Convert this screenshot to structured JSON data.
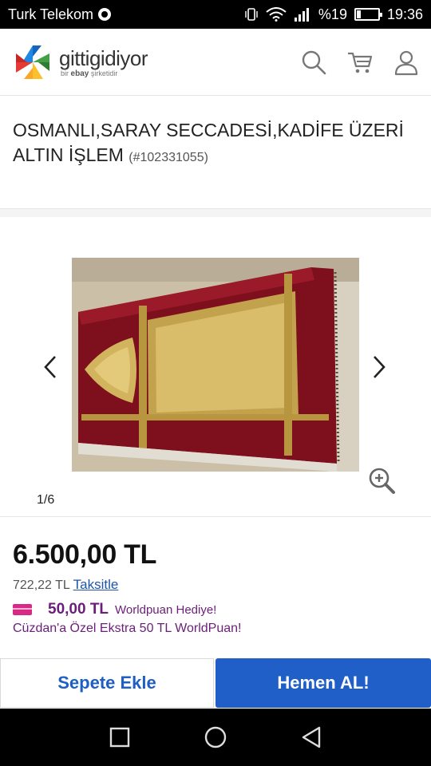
{
  "status_bar": {
    "carrier": "Turk Telekom",
    "battery": "%19",
    "battery_level": 0.19,
    "time": "19:36",
    "icons": [
      "whatsapp-icon",
      "vibrate-icon",
      "wifi-icon",
      "signal-icon",
      "battery-icon"
    ]
  },
  "header": {
    "logo_name": "gittigidiyor",
    "logo_sub_prefix": "bir",
    "logo_sub_brand": "ebay",
    "logo_sub_suffix": "şirketidir",
    "icons": [
      "search-icon",
      "cart-icon",
      "user-icon"
    ]
  },
  "product": {
    "title": "OSMANLI,SARAY SECCADESİ,KADİFE ÜZERİ ALTIN İŞLEM",
    "item_no": "(#102331055)"
  },
  "gallery": {
    "counter": "1/6",
    "icons": [
      "chevron-left-icon",
      "chevron-right-icon",
      "zoom-in-icon"
    ]
  },
  "price": {
    "amount": "6.500,00 TL",
    "installment_amount": "722,22 TL",
    "installment_link": "Taksitle",
    "worldpuan_amount": "50,00 TL",
    "worldpuan_text": "Worldpuan Hediye!",
    "promo": "Cüzdan'a Özel Ekstra 50 TL WorldPuan!"
  },
  "actions": {
    "add_to_cart": "Sepete Ekle",
    "buy_now": "Hemen AL!"
  },
  "colors": {
    "primary_blue": "#1f5fc7",
    "link_blue": "#1e55a8",
    "worldpuan_purple": "#6b1e79",
    "card_pink": "#d62a86"
  },
  "navbar": {
    "icons": [
      "recents-square-icon",
      "home-circle-icon",
      "back-triangle-icon"
    ]
  }
}
